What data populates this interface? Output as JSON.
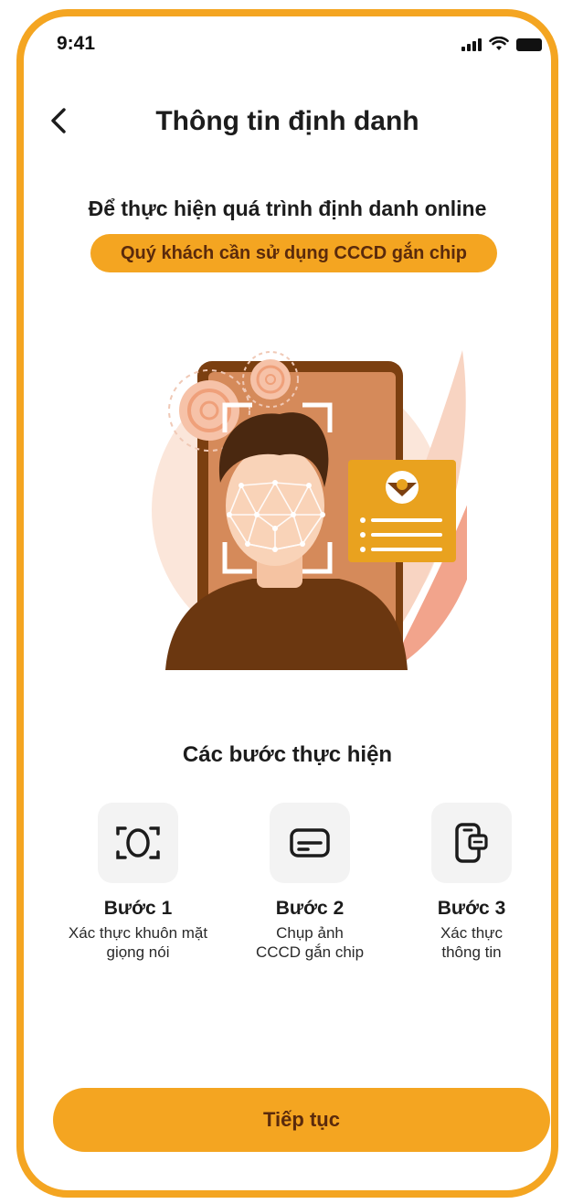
{
  "status_bar": {
    "time": "9:41"
  },
  "header": {
    "title": "Thông tin định danh"
  },
  "intro": {
    "text": "Để thực hiện quá trình định danh online",
    "requirement": "Quý khách cần sử dụng CCCD gắn chip"
  },
  "steps_section": {
    "title": "Các bước thực hiện",
    "steps": [
      {
        "title": "Bước 1",
        "line1": "Xác thực khuôn mặt",
        "line2": "giọng nói",
        "icon": "face-scan-icon"
      },
      {
        "title": "Bước 2",
        "line1": "Chụp ảnh",
        "line2": "CCCD gắn chip",
        "icon": "id-card-icon"
      },
      {
        "title": "Bước 3",
        "line1": "Xác thực",
        "line2": "thông tin",
        "icon": "phone-card-icon"
      }
    ]
  },
  "actions": {
    "continue_label": "Tiếp tục"
  },
  "colors": {
    "accent": "#F4A521",
    "accent_text": "#5a2a0c",
    "text": "#1c1c1c",
    "icon_bg": "#f3f3f3"
  }
}
